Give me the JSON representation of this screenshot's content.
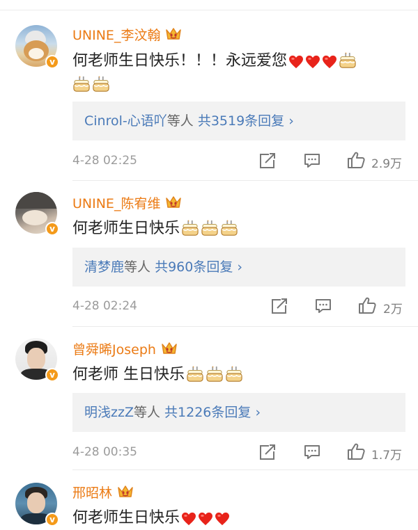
{
  "comments": [
    {
      "username": "UNINE_李汶翰",
      "text": "何老师生日快乐！！！永远爱您",
      "reply_users": "Cinrol-心语吖",
      "reply_mid": "等人",
      "reply_count": "共3519条回复",
      "time": "4-28 02:25",
      "likes": "2.9万"
    },
    {
      "username": "UNINE_陈宥维",
      "text": "何老师生日快乐",
      "reply_users": "清梦鹿",
      "reply_mid": "等人",
      "reply_count": "共960条回复",
      "time": "4-28 02:24",
      "likes": "2万"
    },
    {
      "username": "曾舜晞Joseph",
      "text": "何老师 生日快乐",
      "reply_users": "明浅zzZ",
      "reply_mid": "等人",
      "reply_count": "共1226条回复",
      "time": "4-28 00:35",
      "likes": "1.7万"
    },
    {
      "username": "邢昭林",
      "text": "何老师生日快乐"
    }
  ],
  "icons": {
    "verified": "verified-badge",
    "crown": "crown-icon",
    "heart": "heart-emoji",
    "cake": "cake-emoji",
    "share": "share-icon",
    "comment": "comment-icon",
    "like": "thumbs-up-icon"
  },
  "colors": {
    "username": "#eb7b15",
    "reply_link": "#4a7ab8",
    "reply_bg": "#f2f2f2",
    "verified": "#f49a1a",
    "heart": "#e8231a"
  }
}
